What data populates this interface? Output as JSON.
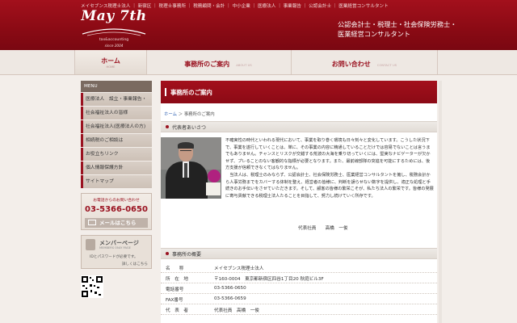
{
  "header": {
    "top_links": "メイセブンス税理士法人 ｜ 新宿区 ｜ 税理士事務所 ｜ 税務顧問・会計 ｜ 中小企業 ｜ 医療法人 ｜ 事業報告 ｜ 公認会計士 ｜ 医業経営コンサルタント",
    "logo": "May 7th",
    "logo_tagline": "tax&accounting",
    "logo_since": "since 2004",
    "tagline_line1": "公認会計士・税理士・社会保険労務士・",
    "tagline_line2": "医業経営コンサルタント",
    "colors": {
      "brand": "#9a1220",
      "beige": "#eee8e3"
    }
  },
  "nav": {
    "home": {
      "label": "ホーム",
      "sub": "HOME"
    },
    "office": {
      "label": "事務所のご案内",
      "sub": "ABOUT US"
    },
    "contact": {
      "label": "お問い合わせ",
      "sub": "CONTACT US"
    }
  },
  "sidebar": {
    "menu_title": "MENU",
    "items": [
      {
        "label": "医療法人　設立・事業報告・"
      },
      {
        "label": "社会福祉法人の皆様"
      },
      {
        "label": "社会福祉法人(医療法人の方)"
      },
      {
        "label": "相続税のご相談は"
      },
      {
        "label": "お役立ちリンク"
      },
      {
        "label": "個人情報保護方針"
      },
      {
        "label": "サイトマップ"
      }
    ],
    "tel_label": "お電話からのお問い合わせ",
    "tel": "03-5366-0650",
    "mail_label": "メールはこちら",
    "member_title": "メンバーページ",
    "member_sub": "MEMBERS ONLY PAGE",
    "member_desc": "IDとパスワードが必要です。",
    "member_link": "詳しくはこちら",
    "mail_icon": "envelope-icon",
    "member_icon": "lock-icon"
  },
  "main": {
    "title": "事務所のご案内",
    "breadcrumb_home": "ホーム",
    "breadcrumb_sep": "＞",
    "breadcrumb_current": "事務所のご案内",
    "greeting_heading": "代表者あいさつ",
    "greeting_p1": "不確実性の時代といわれる現代において、事業を取り巻く環境も日々刻々と変化しています。こうした状況下で、事業を遂行していくことは、単に、その事業の内容に精通していることだけでは容易でないことは言うまでもありません。チャンスとリスクが交錯する荒波の大海を乗り切っていくには、堅実なナビゲーターが欠かせず、プレることのない客観的な指標が必要となります。また、最前線部隊の突進を可能にするためには、後方支援が信頼できなくてはなりません。",
    "greeting_p2": "当法人は、税理士のみならず、公認会計士、社会保険労務士、医業経営コンサルタントを擁し、税務会計から人事労務までをカバーする体制を整え、経営者の皆様に、判断を誤らせない数字を提供し、適正な処理と手続きのお手伝いをさせていただきます。そして、顧客の皆様の繁栄こそが、私たち法人の繁栄です。皆様の発展に寄与貢献できる税理士法人たることを目指して、努力し続けていく所存です。",
    "signature": "代表社員　　高橋　一俊",
    "overview_heading": "事務所の概要",
    "info": [
      {
        "k": "名　　称",
        "v": "メイセブンス税理士法人"
      },
      {
        "k": "所　在　地",
        "v": "〒160-0004　東京都新宿区四谷1丁目20 秋庭ビル3F"
      },
      {
        "k": "電話番号",
        "v": "03-5366-0650"
      },
      {
        "k": "FAX番号",
        "v": "03-5366-0659"
      },
      {
        "k": "代　表　者",
        "v": "代表社員　高橋　一俊"
      }
    ]
  }
}
